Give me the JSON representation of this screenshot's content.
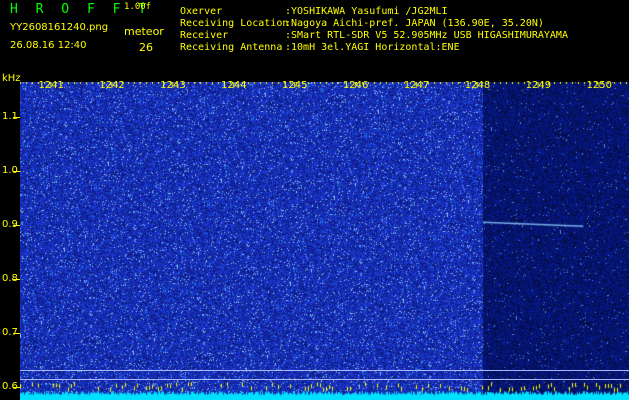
{
  "header": {
    "app_title": "H R O F F T",
    "version": "1.00f",
    "filename": "YY2608161240.png",
    "datetime": "26.08.16 12:40",
    "meteor_label": "meteor",
    "meteor_count": "26"
  },
  "info": [
    {
      "label": "Oxerver",
      "value": ":YOSHIKAWA Yasufumi /JG2MLI"
    },
    {
      "label": "Receiving Location",
      "value": ":Nagoya Aichi-pref. JAPAN (136.90E, 35.20N)"
    },
    {
      "label": "Receiver",
      "value": ":SMart RTL-SDR V5 52.905MHz USB HIGASHIMURAYAMA"
    },
    {
      "label": "Receiving Antenna",
      "value": ":10mH 3el.YAGI Horizontal:ENE"
    }
  ],
  "colors": {
    "background": "#000000",
    "label_yellow": "#ffff00",
    "title_green": "#00ff00",
    "noise_blue": "#1020c8",
    "baseline_cyan": "#00e0ff"
  },
  "chart_data": {
    "type": "heatmap",
    "y_unit": "kHz",
    "x_tick_labels": [
      "1241",
      "1242",
      "1243",
      "1244",
      "1245",
      "1246",
      "1247",
      "1248",
      "1249",
      "1250"
    ],
    "x_range": [
      1240.5,
      1250.5
    ],
    "y_tick_labels": [
      "1.1",
      "1.0",
      "0.9",
      "0.8",
      "0.7",
      "0.6"
    ],
    "y_ticks": [
      1.1,
      1.0,
      0.9,
      0.8,
      0.7,
      0.6
    ],
    "y_range": [
      0.575,
      1.165
    ],
    "dark_region_start_minute": 1248.1,
    "meteor_trace": {
      "x_start": 1248.1,
      "x_end": 1249.75,
      "frequency_khz": 0.905
    }
  }
}
